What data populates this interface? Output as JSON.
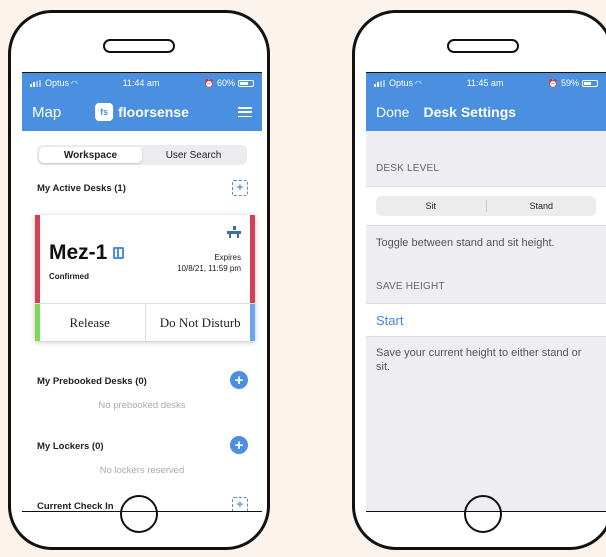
{
  "phone_a": {
    "status": {
      "carrier": "Optus",
      "time": "11:44 am",
      "battery": "60%"
    },
    "nav": {
      "left": "Map",
      "logo_mark": "fs",
      "logo_text": "floorsense"
    },
    "segment": {
      "options": [
        "Workspace",
        "User Search"
      ],
      "selected": "Workspace"
    },
    "active_desks": {
      "title": "My Active Desks (1)",
      "card": {
        "name": "Mez-1",
        "status": "Confirmed",
        "expires_label": "Expires",
        "expires_value": "10/8/21, 11:59 pm",
        "actions": [
          "Release",
          "Do Not Disturb"
        ]
      }
    },
    "prebooked": {
      "title": "My Prebooked Desks (0)",
      "empty": "No prebooked desks"
    },
    "lockers": {
      "title": "My Lockers (0)",
      "empty": "No lockers reserved"
    },
    "checkin": {
      "title": "Current Check In"
    }
  },
  "phone_b": {
    "status": {
      "carrier": "Optus",
      "time": "11:45 am",
      "battery": "59%"
    },
    "nav": {
      "done": "Done",
      "title": "Desk Settings"
    },
    "desk_level": {
      "label": "DESK LEVEL",
      "options": [
        "Sit",
        "Stand"
      ],
      "footer": "Toggle between stand and sit height."
    },
    "save_height": {
      "label": "SAVE HEIGHT",
      "action": "Start",
      "footer": "Save your current height to either stand or sit."
    }
  },
  "colors": {
    "accent": "#4a8fe0",
    "booked": "#d64055",
    "release": "#7ed957",
    "dnd": "#6aa3ef"
  },
  "icons": [
    "signal-icon",
    "wifi-icon",
    "alarm-icon",
    "battery-icon",
    "hamburger-icon",
    "add-desk-icon",
    "map-icon",
    "desk-icon",
    "plus-icon"
  ]
}
